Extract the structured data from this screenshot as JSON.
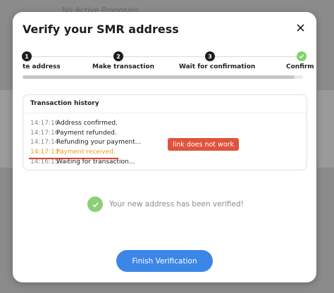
{
  "backdrop": {
    "text": "No Active Proposals"
  },
  "modal": {
    "title": "Verify your SMR address"
  },
  "stepper": {
    "steps": [
      {
        "number": "1",
        "label": "te address",
        "state": "active"
      },
      {
        "number": "2",
        "label": "Make transaction",
        "state": "active"
      },
      {
        "number": "3",
        "label": "Wait for confirmation",
        "state": "active"
      },
      {
        "number": "",
        "label": "Confirm",
        "state": "done"
      }
    ],
    "progress": 0.97
  },
  "history": {
    "title": "Transaction history",
    "rows": [
      {
        "time": "14:17:16",
        "message": "Address confirmed.",
        "status": "normal"
      },
      {
        "time": "14:17:16",
        "message": "Payment refunded.",
        "status": "normal"
      },
      {
        "time": "14:17:14",
        "message": "Refunding your payment...",
        "status": "normal"
      },
      {
        "time": "14:17:13",
        "message": "Payment received.",
        "status": "warning"
      },
      {
        "time": "14:16:15",
        "message": "Waiting for transaction...",
        "status": "normal"
      }
    ]
  },
  "annotation": {
    "text": "link does not work"
  },
  "verified": {
    "text": "Your new address has been verified!"
  },
  "finish_button": {
    "label": "Finish Verification"
  },
  "colors": {
    "accent": "#3b86e6",
    "success": "#7ed36a",
    "warning": "#e5a321",
    "annotation": "#e0533c"
  }
}
